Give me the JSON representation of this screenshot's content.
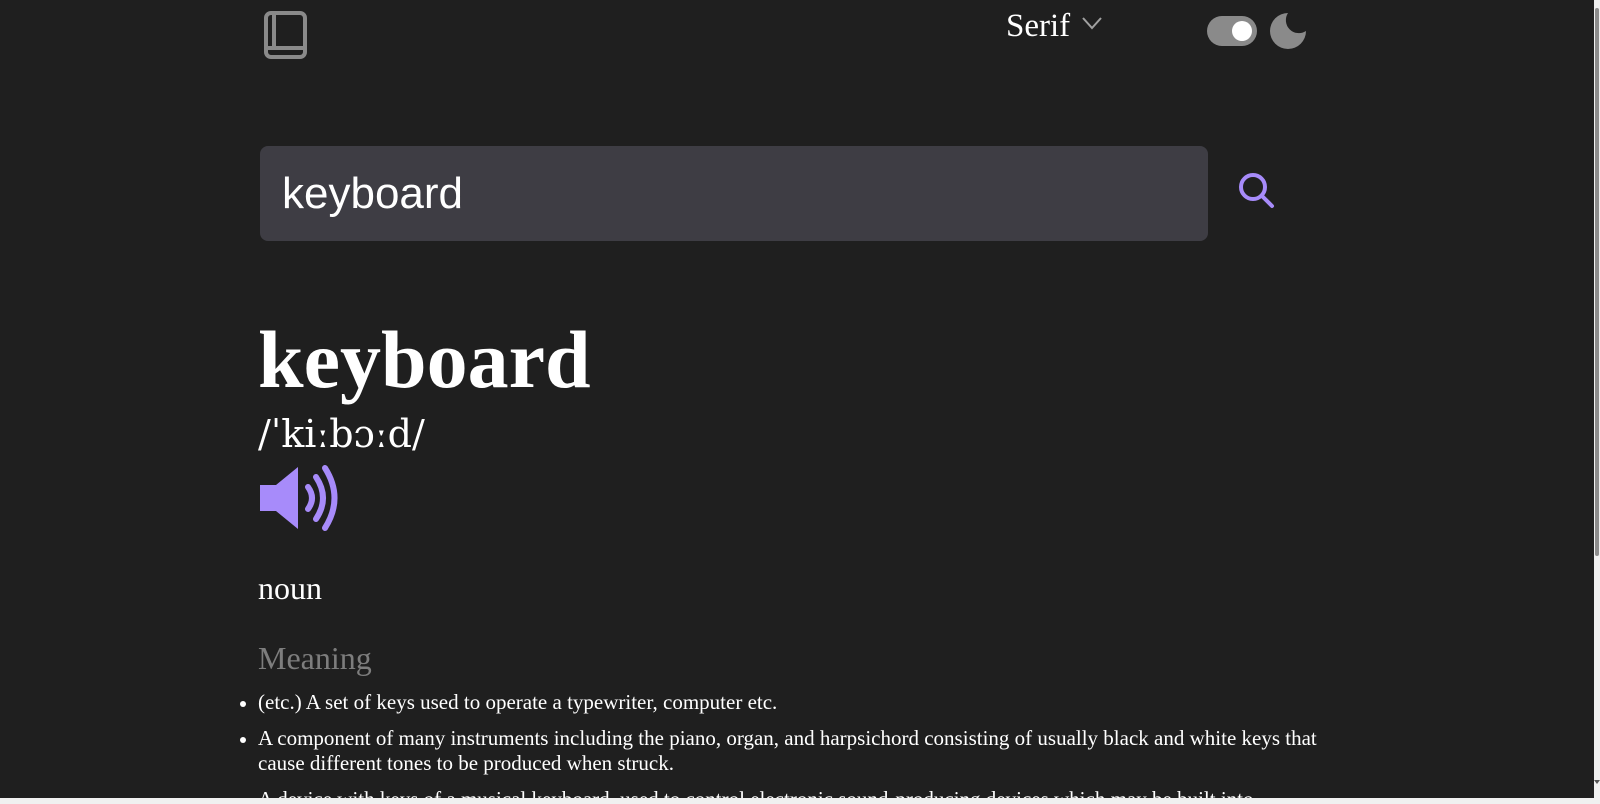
{
  "header": {
    "logo_icon": "book-icon",
    "font_select": {
      "selected": "Serif",
      "icon": "chevron-down-icon"
    },
    "theme_toggle": {
      "state": "on",
      "icon": "toggle-icon"
    },
    "theme_icon": "moon-icon"
  },
  "search": {
    "value": "keyboard",
    "placeholder": "",
    "icon": "search-icon"
  },
  "entry": {
    "word": "keyboard",
    "phonetic": "/ˈkiːbɔːd/",
    "audio_icon": "speaker-icon",
    "part_of_speech": "noun",
    "meaning_heading": "Meaning",
    "meanings": [
      "(etc.) A set of keys used to operate a typewriter, computer etc.",
      "A component of many instruments including the piano, organ, and harpsichord consisting of usually black and white keys that cause different tones to be produced when struck.",
      "A device with keys of a musical keyboard, used to control electronic sound-producing devices which may be built into"
    ]
  },
  "colors": {
    "background": "#1f1f1f",
    "search_background": "#3e3d44",
    "accent": "#a78bfa",
    "muted_text": "#7d7d7d",
    "text": "#ffffff"
  }
}
